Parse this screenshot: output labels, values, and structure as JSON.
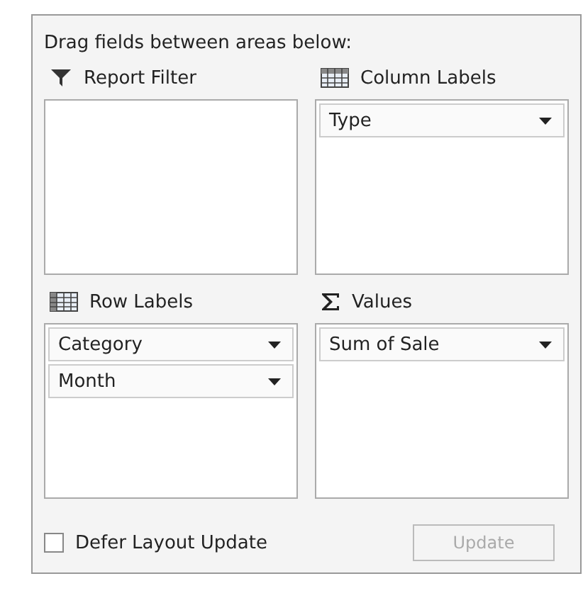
{
  "instruction": "Drag fields between areas below:",
  "areas": [
    {
      "kind": "filter",
      "label": "Report Filter"
    },
    {
      "kind": "columns",
      "label": "Column Labels",
      "fields": [
        "Type"
      ]
    },
    {
      "kind": "rows",
      "label": "Row Labels",
      "fields": [
        "Category",
        "Month"
      ]
    },
    {
      "kind": "values",
      "label": "Values",
      "fields": [
        "Sum of Sale"
      ]
    }
  ],
  "defer_layout_update": {
    "label": "Defer Layout Update",
    "checked": false
  },
  "update_button": {
    "label": "Update",
    "disabled": true
  }
}
